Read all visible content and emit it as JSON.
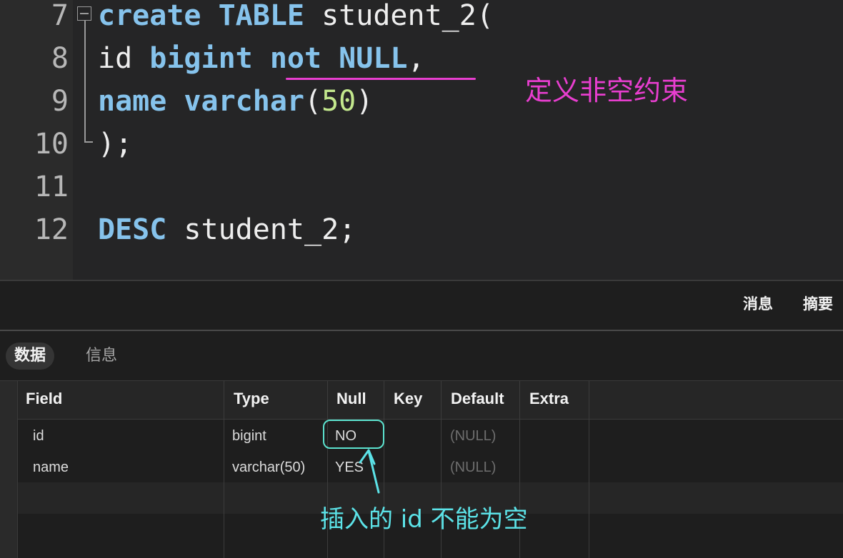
{
  "editor": {
    "lines": [
      {
        "number": "7"
      },
      {
        "number": "8"
      },
      {
        "number": "9"
      },
      {
        "number": "10"
      },
      {
        "number": "11"
      },
      {
        "number": "12"
      }
    ],
    "code": {
      "l7_kw1": "create",
      "l7_kw2": "TABLE",
      "l7_rest": " student_2(",
      "l8_id": "id ",
      "l8_kw1": "bigint",
      "l8_kw2": "not NULL",
      "l8_comma": ",",
      "l9_kw1": "name",
      "l9_kw2": "varchar",
      "l9_paren1": "(",
      "l9_num": "50",
      "l9_paren2": ")",
      "l10": ");",
      "l12_kw": "DESC",
      "l12_rest": " student_2;"
    },
    "annotation": "定义非空约束"
  },
  "toolbar": {
    "messages_label": "消息",
    "summary_label": "摘要"
  },
  "tabs": [
    {
      "label": "数据",
      "active": true
    },
    {
      "label": "信息",
      "active": false
    }
  ],
  "result_table": {
    "columns": [
      "Field",
      "Type",
      "Null",
      "Key",
      "Default",
      "Extra"
    ],
    "rows": [
      {
        "field": "id",
        "type": "bigint",
        "null": "NO",
        "key": "",
        "default": "(NULL)",
        "extra": ""
      },
      {
        "field": "name",
        "type": "varchar(50)",
        "null": "YES",
        "key": "",
        "default": "(NULL)",
        "extra": ""
      }
    ]
  },
  "annotation_result": "插入的 id 不能为空",
  "colors": {
    "keyword": "#86c3ec",
    "number": "#c3e88d",
    "annotation_pink": "#e83ecf",
    "annotation_cyan": "#5ce3e8"
  }
}
